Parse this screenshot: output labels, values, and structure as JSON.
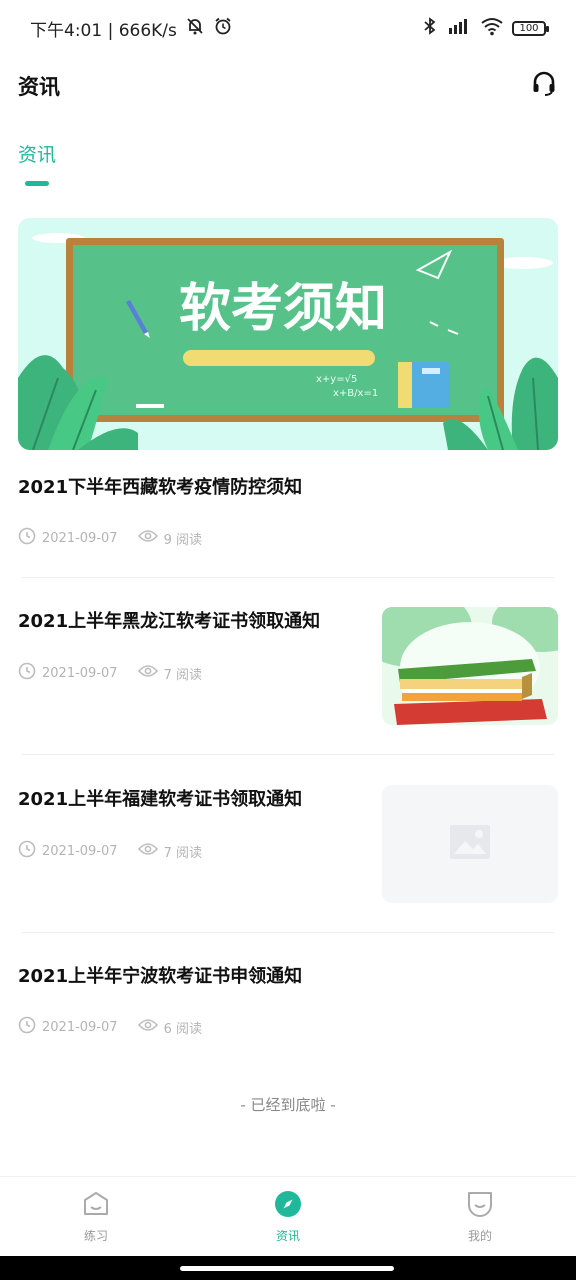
{
  "status_bar": {
    "time_speed": "下午4:01 | 666K/s",
    "battery": "100"
  },
  "header": {
    "title": "资讯",
    "support_icon": "headset-icon"
  },
  "tabs": [
    {
      "label": "资讯",
      "active": true
    }
  ],
  "banner": {
    "text": "软考须知",
    "formula_1": "x+y=√5",
    "formula_2": "x+B/x=1"
  },
  "articles": [
    {
      "title": "2021下半年西藏软考疫情防控须知",
      "date": "2021-09-07",
      "views": "9 阅读",
      "thumbnail": "none"
    },
    {
      "title": "2021上半年黑龙江软考证书领取通知",
      "date": "2021-09-07",
      "views": "7 阅读",
      "thumbnail": "books"
    },
    {
      "title": "2021上半年福建软考证书领取通知",
      "date": "2021-09-07",
      "views": "7 阅读",
      "thumbnail": "placeholder"
    },
    {
      "title": "2021上半年宁波软考证书申领通知",
      "date": "2021-09-07",
      "views": "6 阅读",
      "thumbnail": "none"
    }
  ],
  "end_text": "- 已经到底啦 -",
  "bottom_nav": [
    {
      "label": "练习",
      "icon": "practice-icon",
      "active": false
    },
    {
      "label": "资讯",
      "icon": "compass-icon",
      "active": true
    },
    {
      "label": "我的",
      "icon": "profile-icon",
      "active": false
    }
  ],
  "colors": {
    "accent": "#20b89a",
    "chalkboard": "#56c28a",
    "board_frame": "#b8823c"
  }
}
